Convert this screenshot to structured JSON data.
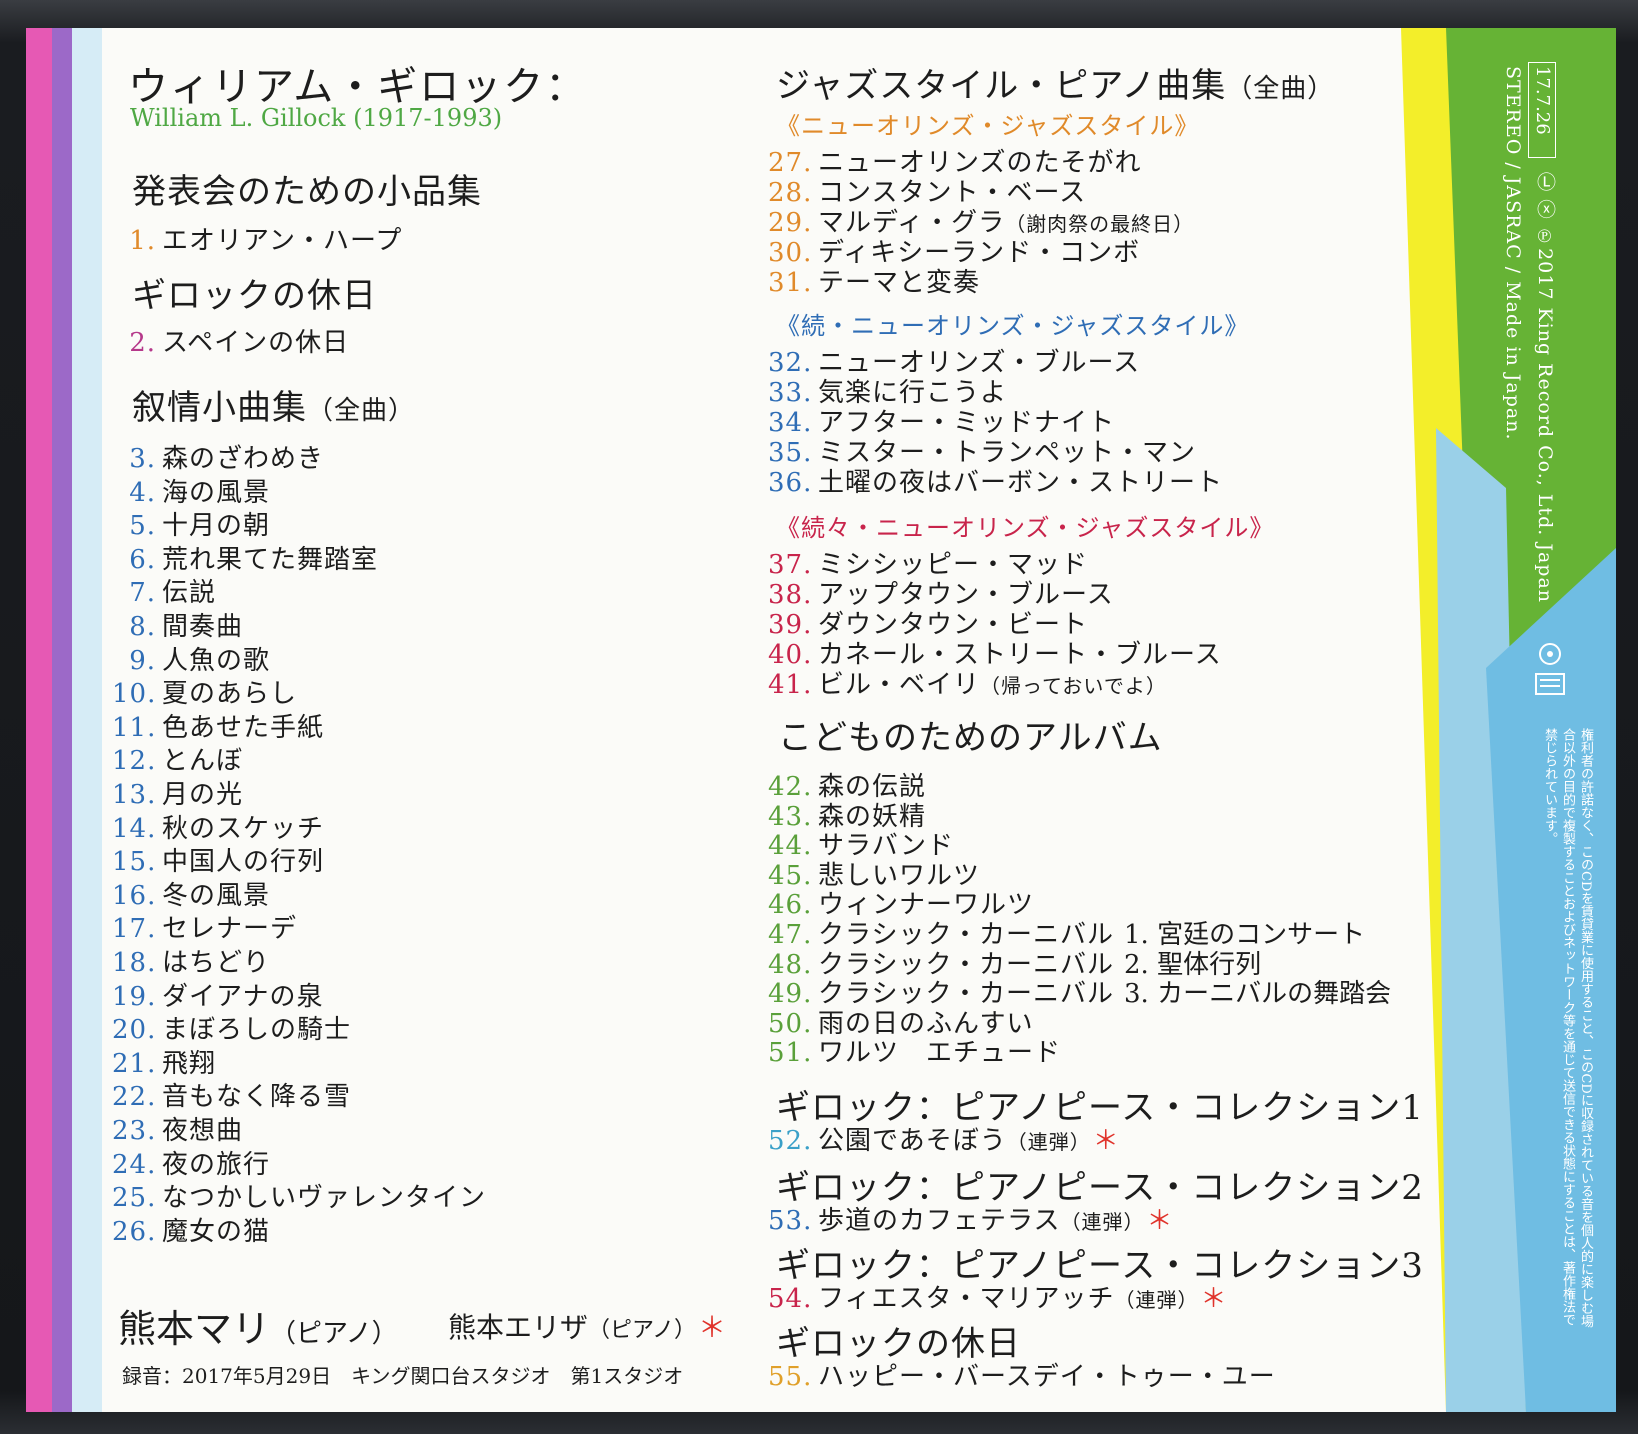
{
  "header": {
    "title": "ウィリアム・ギロック：",
    "title_en": "William L. Gillock (1917-1993)"
  },
  "colors": {
    "orange": "#e08a2a",
    "magenta": "#b5388a",
    "blue": "#2f6db5",
    "red": "#c8244b",
    "green": "#5aa03a",
    "cyan": "#3aa0c8",
    "title_green": "#4fa844"
  },
  "left": {
    "section1": {
      "title": "発表会のための小品集",
      "tracks": [
        {
          "num": "1.",
          "title": "エオリアン・ハープ"
        }
      ]
    },
    "section2": {
      "title": "ギロックの休日",
      "tracks": [
        {
          "num": "2.",
          "title": "スペインの休日"
        }
      ]
    },
    "section3": {
      "title": "叙情小曲集",
      "paren": "（全曲）",
      "tracks": [
        {
          "num": "3.",
          "title": "森のざわめき"
        },
        {
          "num": "4.",
          "title": "海の風景"
        },
        {
          "num": "5.",
          "title": "十月の朝"
        },
        {
          "num": "6.",
          "title": "荒れ果てた舞踏室"
        },
        {
          "num": "7.",
          "title": "伝説"
        },
        {
          "num": "8.",
          "title": "間奏曲"
        },
        {
          "num": "9.",
          "title": "人魚の歌"
        },
        {
          "num": "10.",
          "title": "夏のあらし"
        },
        {
          "num": "11.",
          "title": "色あせた手紙"
        },
        {
          "num": "12.",
          "title": "とんぼ"
        },
        {
          "num": "13.",
          "title": "月の光"
        },
        {
          "num": "14.",
          "title": "秋のスケッチ"
        },
        {
          "num": "15.",
          "title": "中国人の行列"
        },
        {
          "num": "16.",
          "title": "冬の風景"
        },
        {
          "num": "17.",
          "title": "セレナーデ"
        },
        {
          "num": "18.",
          "title": "はちどり"
        },
        {
          "num": "19.",
          "title": "ダイアナの泉"
        },
        {
          "num": "20.",
          "title": "まぼろしの騎士"
        },
        {
          "num": "21.",
          "title": "飛翔"
        },
        {
          "num": "22.",
          "title": "音もなく降る雪"
        },
        {
          "num": "23.",
          "title": "夜想曲"
        },
        {
          "num": "24.",
          "title": "夜の旅行"
        },
        {
          "num": "25.",
          "title": "なつかしいヴァレンタイン"
        },
        {
          "num": "26.",
          "title": "魔女の猫"
        }
      ]
    },
    "performers": {
      "p1": "熊本マリ",
      "p1_paren": "（ピアノ）",
      "p2": "熊本エリザ",
      "p2_paren": "（ピアノ）",
      "star": "＊",
      "recording": "録音：2017年5月29日　キング関口台スタジオ　第1スタジオ"
    }
  },
  "right": {
    "section1": {
      "title": "ジャズスタイル・ピアノ曲集",
      "paren": "（全曲）"
    },
    "sub1": {
      "title": "《ニューオリンズ・ジャズスタイル》",
      "tracks": [
        {
          "num": "27.",
          "title": "ニューオリンズのたそがれ"
        },
        {
          "num": "28.",
          "title": "コンスタント・ベース"
        },
        {
          "num": "29.",
          "title": "マルディ・グラ",
          "small": "（謝肉祭の最終日）"
        },
        {
          "num": "30.",
          "title": "ディキシーランド・コンボ"
        },
        {
          "num": "31.",
          "title": "テーマと変奏"
        }
      ]
    },
    "sub2": {
      "title": "《続・ニューオリンズ・ジャズスタイル》",
      "tracks": [
        {
          "num": "32.",
          "title": "ニューオリンズ・ブルース"
        },
        {
          "num": "33.",
          "title": "気楽に行こうよ"
        },
        {
          "num": "34.",
          "title": "アフター・ミッドナイト"
        },
        {
          "num": "35.",
          "title": "ミスター・トランペット・マン"
        },
        {
          "num": "36.",
          "title": "土曜の夜はバーボン・ストリート"
        }
      ]
    },
    "sub3": {
      "title": "《続々・ニューオリンズ・ジャズスタイル》",
      "tracks": [
        {
          "num": "37.",
          "title": "ミシシッピー・マッド"
        },
        {
          "num": "38.",
          "title": "アップタウン・ブルース"
        },
        {
          "num": "39.",
          "title": "ダウンタウン・ビート"
        },
        {
          "num": "40.",
          "title": "カネール・ストリート・ブルース"
        },
        {
          "num": "41.",
          "title": "ビル・ベイリ",
          "small": "（帰っておいでよ）"
        }
      ]
    },
    "section2": {
      "title": "こどものためのアルバム",
      "tracks": [
        {
          "num": "42.",
          "title": "森の伝説"
        },
        {
          "num": "43.",
          "title": "森の妖精"
        },
        {
          "num": "44.",
          "title": "サラバンド"
        },
        {
          "num": "45.",
          "title": "悲しいワルツ"
        },
        {
          "num": "46.",
          "title": "ウィンナーワルツ"
        },
        {
          "num": "47.",
          "title": "クラシック・カーニバル",
          "sub": "1. 宮廷のコンサート"
        },
        {
          "num": "48.",
          "title": "クラシック・カーニバル",
          "sub": "2. 聖体行列"
        },
        {
          "num": "49.",
          "title": "クラシック・カーニバル",
          "sub": "3. カーニバルの舞踏会"
        },
        {
          "num": "50.",
          "title": "雨の日のふんすい"
        },
        {
          "num": "51.",
          "title": "ワルツ　エチュード"
        }
      ]
    },
    "section3": {
      "title": "ギロック：ピアノピース・コレクション1",
      "track": {
        "num": "52.",
        "title": "公園であそぼう",
        "small": "（連弾）"
      }
    },
    "section4": {
      "title": "ギロック：ピアノピース・コレクション2",
      "track": {
        "num": "53.",
        "title": "歩道のカフェテラス",
        "small": "（連弾）"
      }
    },
    "section5": {
      "title": "ギロック：ピアノピース・コレクション3",
      "track": {
        "num": "54.",
        "title": "フィエスタ・マリアッチ",
        "small": "（連弾）"
      }
    },
    "section6": {
      "title": "ギロックの休日",
      "track": {
        "num": "55.",
        "title": "ハッピー・バースデイ・トゥー・ユー"
      }
    }
  },
  "spine": {
    "date": "17.7.26",
    "copyright": "Ⓛ ⓧ ℗2017 King Record Co., Ltd. Japan",
    "stereo": "STEREO / JASRAC / Made in Japan.",
    "notice": "権利者の許諾なく、このCDを賃貸業に使用すること、このCDに収録されている音を個人的に楽しむ場合以外の目的で複製することおよびネットワーク等を通じて送信できる状態にすることは、著作権法で禁じられています。"
  }
}
